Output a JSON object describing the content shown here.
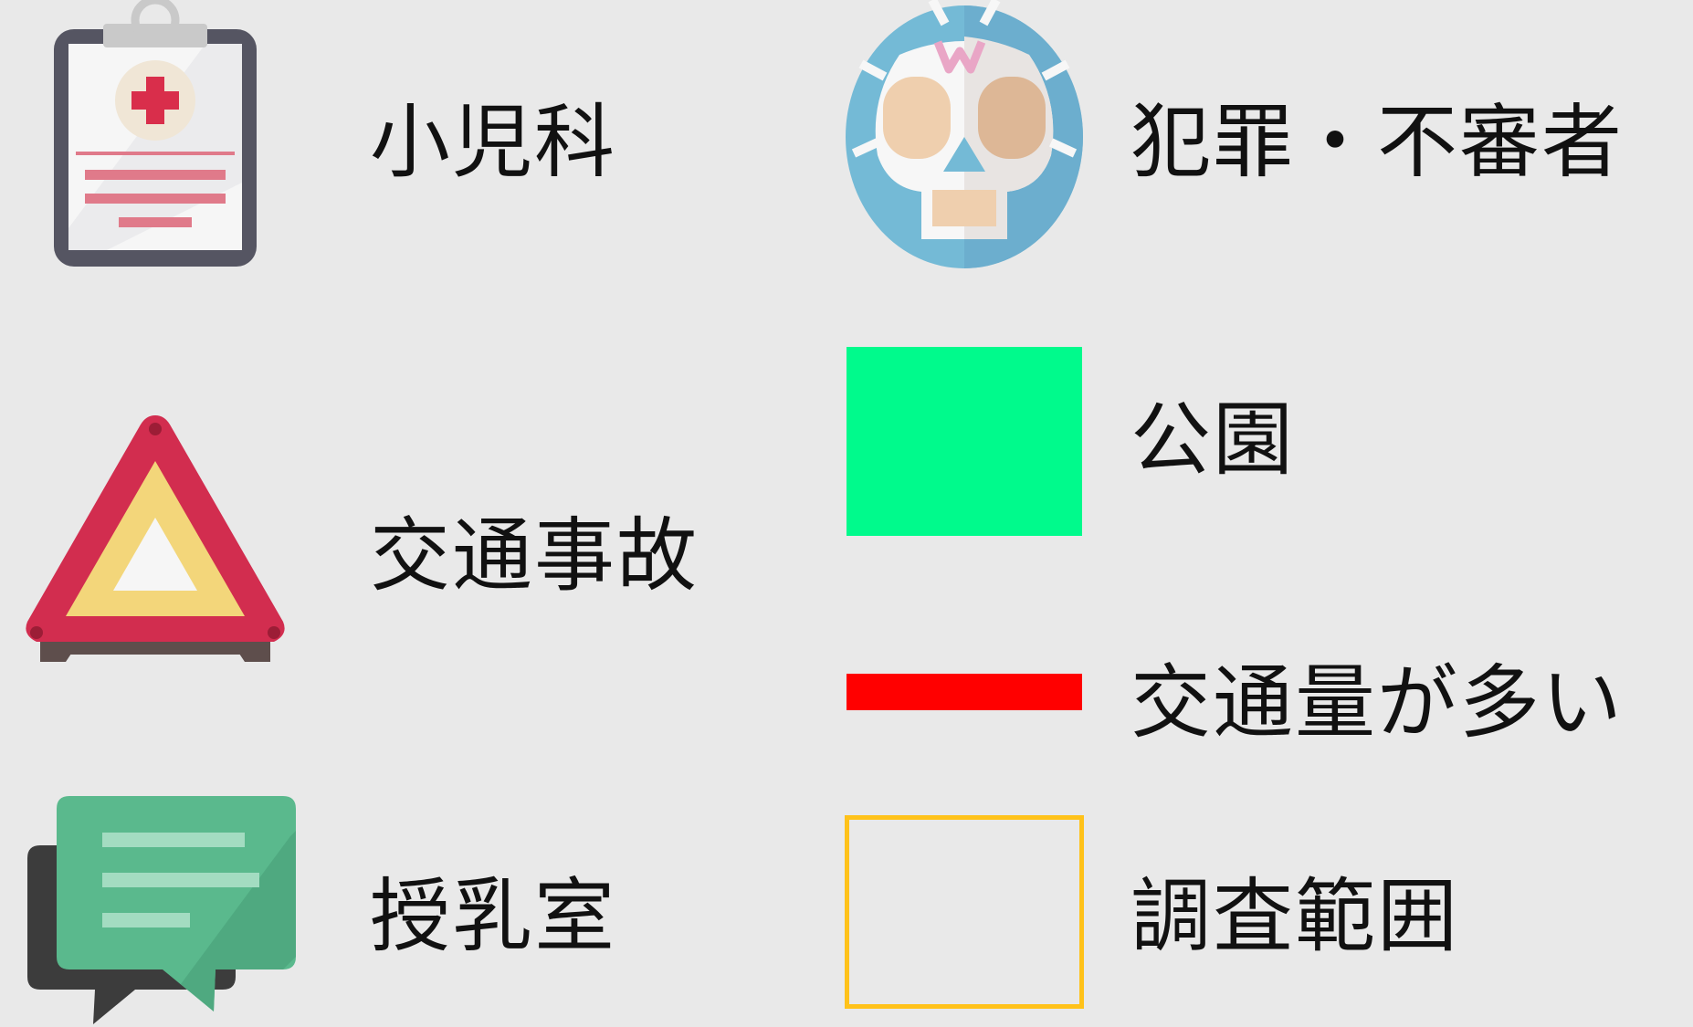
{
  "legend": {
    "items": [
      {
        "label": "小児科",
        "icon": "clipboard-medical-icon"
      },
      {
        "label": "交通事故",
        "icon": "warning-triangle-icon"
      },
      {
        "label": "授乳室",
        "icon": "chat-bubble-icon"
      },
      {
        "label": "犯罪・不審者",
        "icon": "wrestler-mask-icon"
      },
      {
        "label": "公園",
        "icon": "green-square-swatch",
        "color": "#00FA8C"
      },
      {
        "label": "交通量が多い",
        "icon": "red-line-swatch",
        "color": "#FF0000"
      },
      {
        "label": "調査範囲",
        "icon": "outline-square-swatch",
        "color": "#FFC21A"
      }
    ]
  }
}
